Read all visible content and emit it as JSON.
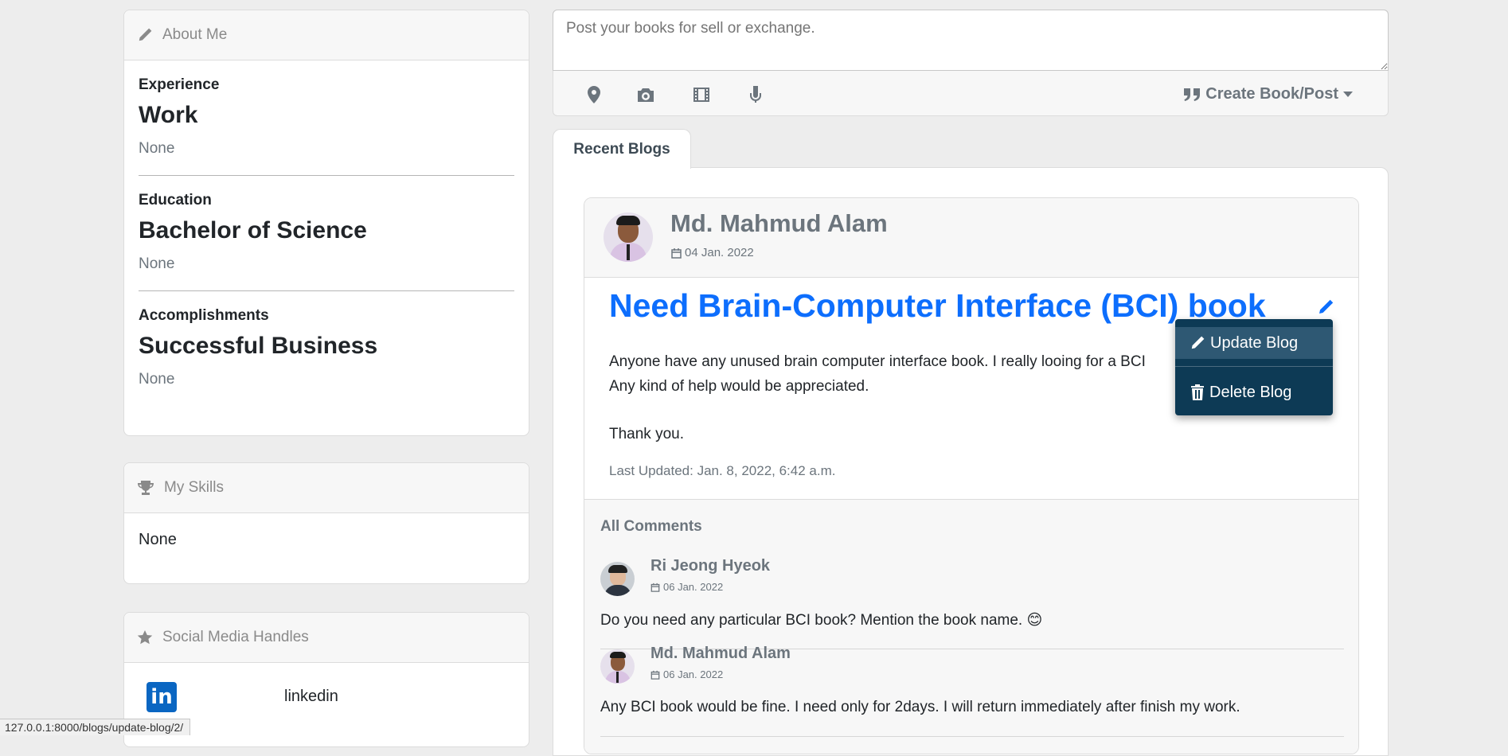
{
  "about": {
    "header": "About Me",
    "sections": [
      {
        "label": "Experience",
        "title": "Work",
        "value": "None"
      },
      {
        "label": "Education",
        "title": "Bachelor of Science",
        "value": "None"
      },
      {
        "label": "Accomplishments",
        "title": "Successful Business",
        "value": "None"
      }
    ]
  },
  "skills": {
    "header": "My Skills",
    "value": "None"
  },
  "social": {
    "header": "Social Media Handles",
    "items": [
      {
        "name": "linkedin",
        "icon": "linkedin-icon"
      }
    ]
  },
  "composer": {
    "placeholder": "Post your books for sell or exchange.",
    "tools": [
      "location-icon",
      "camera-icon",
      "film-icon",
      "microphone-icon"
    ],
    "create_label": "Create Book/Post"
  },
  "tabs": {
    "active": "Recent Blogs"
  },
  "post": {
    "author": "Md. Mahmud Alam",
    "date": "04 Jan. 2022",
    "title": "Need Brain-Computer Interface (BCI) book",
    "body_line1": "Anyone have any unused brain computer interface book. I really looing for a BCI",
    "body_line2": "Any kind of help would be appreciated.",
    "body_line3": "Thank you.",
    "updated": "Last Updated: Jan. 8, 2022, 6:42 a.m.",
    "menu": {
      "update": "Update Blog",
      "delete": "Delete Blog"
    }
  },
  "comments": {
    "header": "All Comments",
    "items": [
      {
        "author": "Ri Jeong Hyeok",
        "date": "06 Jan. 2022",
        "text": "Do you need any particular BCI book? Mention the book name. 😊"
      },
      {
        "author": "Md. Mahmud Alam",
        "date": "06 Jan. 2022",
        "text": "Any BCI book would be fine. I need only for 2days. I will return immediately after finish my work."
      }
    ]
  },
  "status_bar": {
    "url": "127.0.0.1:8000/blogs/update-blog/2/"
  },
  "colors": {
    "link_blue": "#0d6efd",
    "dropdown_bg": "#0d3a55",
    "dropdown_active": "#2e5873"
  }
}
